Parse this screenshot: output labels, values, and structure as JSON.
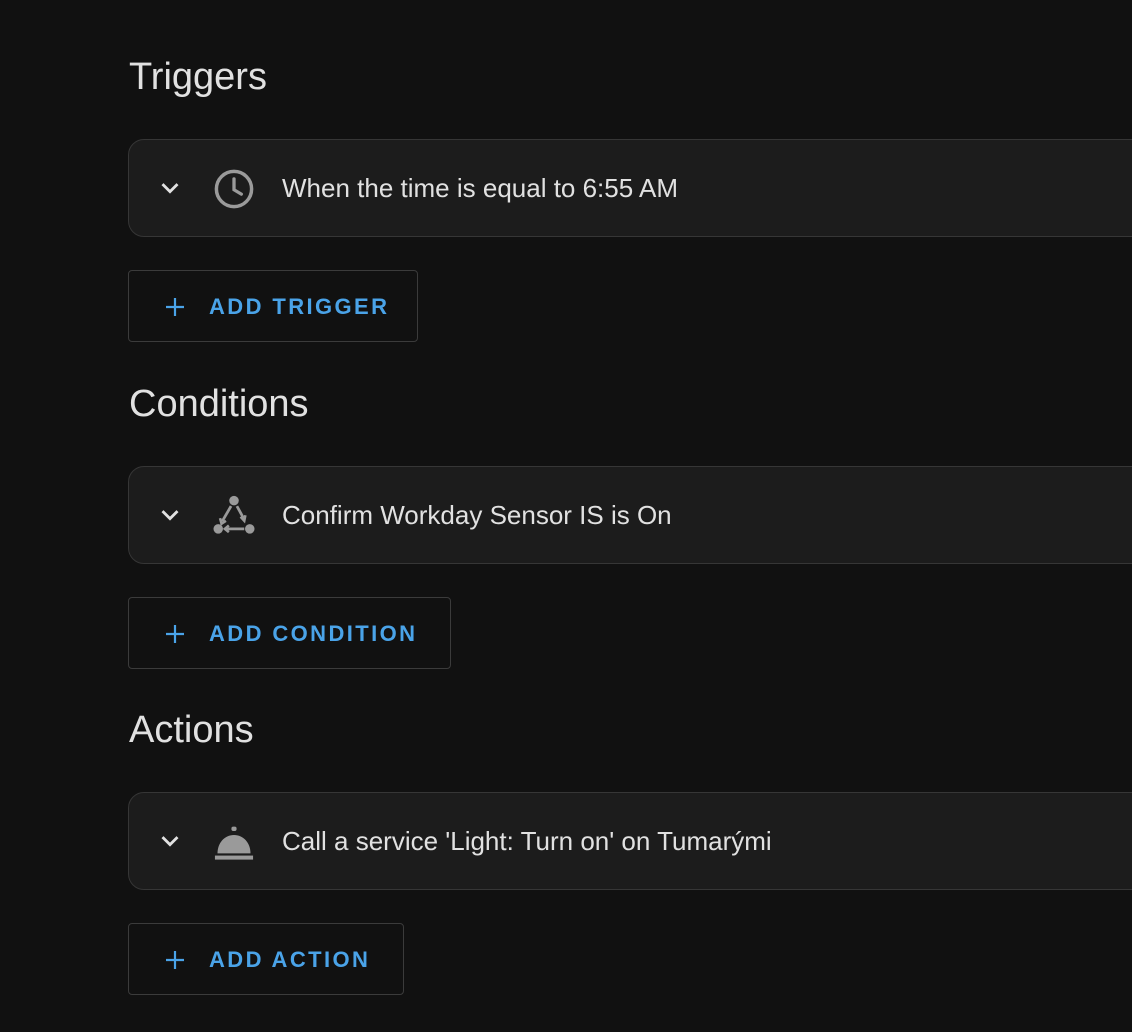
{
  "colors": {
    "background": "#111111",
    "card_background": "#1c1c1c",
    "card_border": "#363636",
    "text": "#e1e1e1",
    "icon": "#9a9a9a",
    "accent": "#4aa3e8"
  },
  "triggers": {
    "title": "Triggers",
    "items": [
      {
        "icon": "clock-icon",
        "label": "When the time is equal to 6:55 AM"
      }
    ],
    "add_label": "ADD TRIGGER"
  },
  "conditions": {
    "title": "Conditions",
    "items": [
      {
        "icon": "state-graph-icon",
        "label": "Confirm Workday Sensor IS is On"
      }
    ],
    "add_label": "ADD CONDITION"
  },
  "actions": {
    "title": "Actions",
    "items": [
      {
        "icon": "service-bell-icon",
        "label": "Call a service 'Light: Turn on' on Tumarými"
      }
    ],
    "add_label": "ADD ACTION"
  }
}
